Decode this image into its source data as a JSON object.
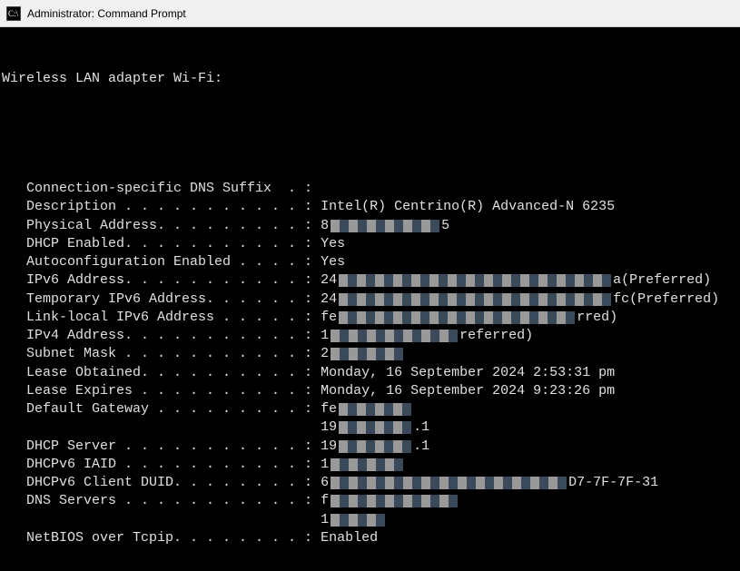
{
  "window": {
    "title": "Administrator: Command Prompt"
  },
  "terminal": {
    "header": "Wireless LAN adapter Wi-Fi:",
    "rows": [
      {
        "label": "   Connection-specific DNS Suffix  . :",
        "value": ""
      },
      {
        "label": "   Description . . . . . . . . . . . : ",
        "value": "Intel(R) Centrino(R) Advanced-N 6235"
      },
      {
        "label": "   Physical Address. . . . . . . . . : ",
        "value_prefix": "8",
        "value_suffix": "5",
        "redacted": true
      },
      {
        "label": "   DHCP Enabled. . . . . . . . . . . : ",
        "value": "Yes"
      },
      {
        "label": "   Autoconfiguration Enabled . . . . : ",
        "value": "Yes"
      },
      {
        "label": "   IPv6 Address. . . . . . . . . . . : ",
        "value_prefix": "24",
        "value_suffix": "a(Preferred)",
        "redacted": true,
        "wide": true
      },
      {
        "label": "   Temporary IPv6 Address. . . . . . : ",
        "value_prefix": "24",
        "value_suffix": "fc(Preferred)",
        "redacted": true,
        "wide": true
      },
      {
        "label": "   Link-local IPv6 Address . . . . . : ",
        "value_prefix": "fe",
        "value_suffix": "rred)",
        "redacted": true,
        "wide2": true
      },
      {
        "label": "   IPv4 Address. . . . . . . . . . . : ",
        "value_prefix": "1",
        "value_suffix": "referred)",
        "redacted": true,
        "mid": true
      },
      {
        "label": "   Subnet Mask . . . . . . . . . . . : ",
        "value_prefix": "2",
        "value_suffix": "",
        "redacted": true,
        "short": true
      },
      {
        "label": "   Lease Obtained. . . . . . . . . . : ",
        "value": "Monday, 16 September 2024 2:53:31 pm"
      },
      {
        "label": "   Lease Expires . . . . . . . . . . : ",
        "value": "Monday, 16 September 2024 9:23:26 pm"
      },
      {
        "label": "   Default Gateway . . . . . . . . . : ",
        "value_prefix": "fe",
        "value_suffix": "",
        "redacted": true,
        "short": true
      },
      {
        "label": "                                       ",
        "value_prefix": "19",
        "value_suffix": ".1",
        "redacted": true,
        "short": true
      },
      {
        "label": "   DHCP Server . . . . . . . . . . . : ",
        "value_prefix": "19",
        "value_suffix": ".1",
        "redacted": true,
        "short": true
      },
      {
        "label": "   DHCPv6 IAID . . . . . . . . . . . : ",
        "value_prefix": "1",
        "value_suffix": "",
        "redacted": true,
        "short": true
      },
      {
        "label": "   DHCPv6 Client DUID. . . . . . . . : ",
        "value_prefix": "6",
        "value_suffix": "D7-7F-7F-31",
        "redacted": true,
        "wide2": true
      },
      {
        "label": "   DNS Servers . . . . . . . . . . . : ",
        "value_prefix": "f",
        "value_suffix": "",
        "redacted": true,
        "mid": true
      },
      {
        "label": "                                       ",
        "value_prefix": "1",
        "value_suffix": "",
        "redacted": true,
        "short2": true
      },
      {
        "label": "   NetBIOS over Tcpip. . . . . . . . : ",
        "value": "Enabled"
      }
    ]
  }
}
